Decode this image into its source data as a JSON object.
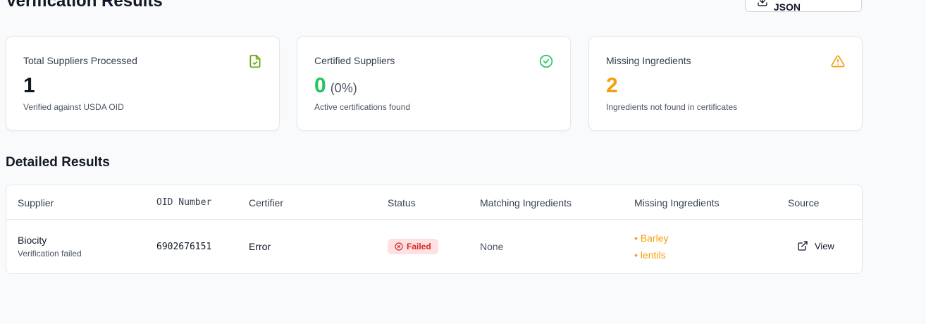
{
  "page": {
    "title": "Verification Results",
    "download_label": "Download JSON"
  },
  "cards": [
    {
      "title": "Total Suppliers Processed",
      "value": "1",
      "pct": "",
      "desc": "Verified against USDA OID",
      "icon": "file-check-icon",
      "color": "#111827"
    },
    {
      "title": "Certified Suppliers",
      "value": "0",
      "pct": "(0%)",
      "desc": "Active certifications found",
      "icon": "circle-check-icon",
      "color": "#22c55e"
    },
    {
      "title": "Missing Ingredients",
      "value": "2",
      "pct": "",
      "desc": "Ingredients not found in certificates",
      "icon": "warning-triangle-icon",
      "color": "#f59e0b"
    }
  ],
  "section": {
    "title": "Detailed Results"
  },
  "table": {
    "headers": {
      "supplier": "Supplier",
      "oid": "OID Number",
      "certifier": "Certifier",
      "status": "Status",
      "matching": "Matching Ingredients",
      "missing": "Missing Ingredients",
      "source": "Source"
    },
    "rows": [
      {
        "supplier": "Biocity",
        "supplier_note": "Verification failed",
        "oid": "6902676151",
        "certifier": "Error",
        "status": "Failed",
        "matching": "None",
        "missing": [
          "Barley",
          "lentils"
        ],
        "source": "View"
      }
    ]
  },
  "colors": {
    "success": "#22c55e",
    "warning": "#f59e0b",
    "danger": "#dc2626",
    "danger_bg": "#fee2e2"
  }
}
